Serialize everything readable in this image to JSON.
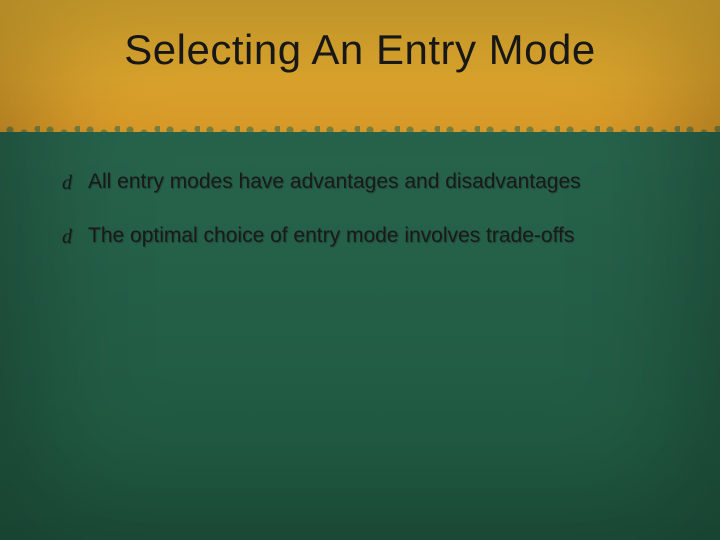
{
  "title": "Selecting An Entry Mode",
  "bullets": [
    "All entry modes have advantages and disadvantages",
    "The optimal choice of entry mode involves trade-offs"
  ],
  "bullet_glyph": "d",
  "colors": {
    "header_gradient_top": "#e6b332",
    "header_gradient_bottom": "#d99a28",
    "body_gradient_top": "#2a6850",
    "body_gradient_bottom": "#1f5840",
    "text": "#1a1a1a"
  }
}
